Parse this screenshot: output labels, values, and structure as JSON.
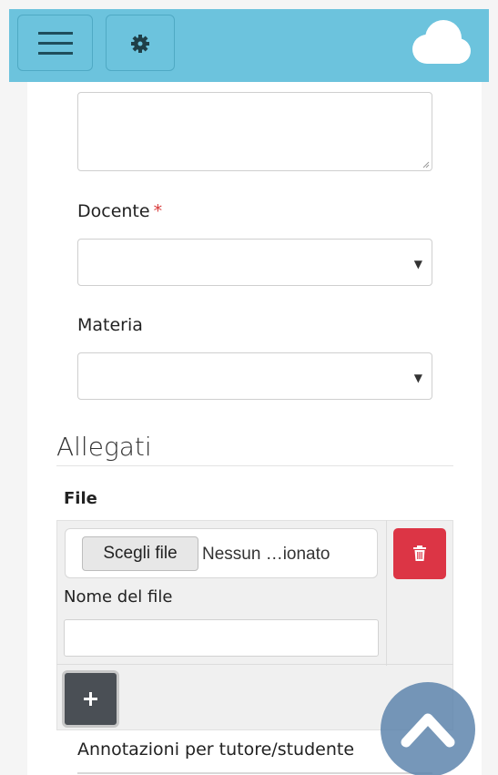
{
  "header": {
    "menu_icon": "hamburger-icon",
    "settings_icon": "gear-icon",
    "brand_icon": "cloud-icon",
    "bar_color": "#6cc3dd"
  },
  "form": {
    "docente_label": "Docente",
    "required_marker": "*",
    "docente_value": "",
    "materia_label": "Materia",
    "materia_value": ""
  },
  "allegati": {
    "section_title": "Allegati",
    "file_label": "File",
    "choose_file_button": "Scegli file",
    "no_file_text": "Nessun …ionato",
    "delete_icon": "trash-icon",
    "delete_color": "#dc3545",
    "filename_label": "Nome del file",
    "filename_value": "",
    "add_icon": "plus-icon"
  },
  "annotations": {
    "label": "Annotazioni per tutore/studente"
  },
  "scroll_top_icon": "chevron-up-icon"
}
